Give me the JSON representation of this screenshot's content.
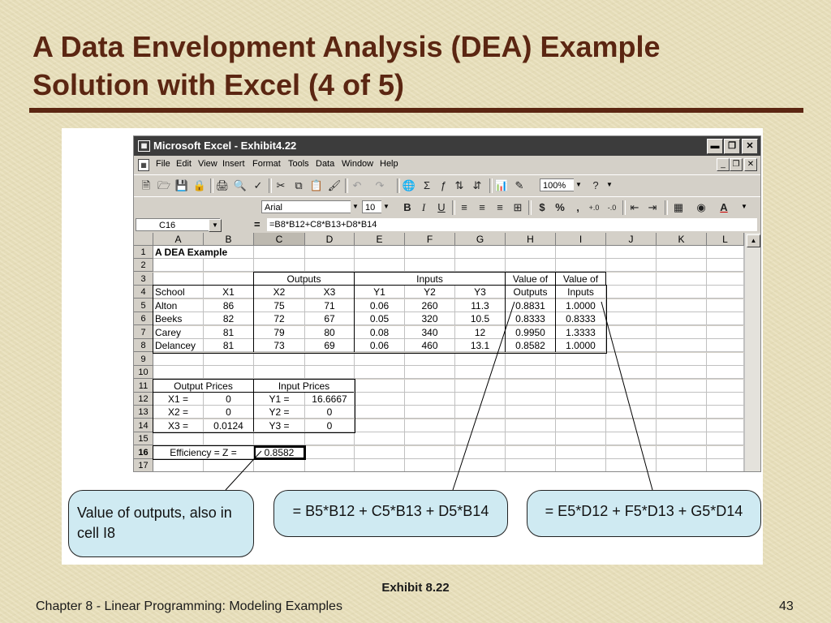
{
  "slide": {
    "title_line1": "A Data Envelopment Analysis (DEA) Example",
    "title_line2": "Solution with Excel (4 of 5)",
    "caption": "Exhibit 8.22",
    "footer_left": "Chapter 8 - Linear Programming:  Modeling Examples",
    "page_number": "43"
  },
  "window": {
    "title": "Microsoft Excel - Exhibit4.22",
    "menu": [
      "File",
      "Edit",
      "View",
      "Insert",
      "Format",
      "Tools",
      "Data",
      "Window",
      "Help"
    ]
  },
  "toolbar": {
    "zoom": "100%",
    "font_name": "Arial",
    "font_size": "10",
    "bold_label": "B",
    "italic_label": "I",
    "underline_label": "U",
    "currency_label": "$",
    "percent_label": "%",
    "comma_label": ","
  },
  "formula_bar": {
    "name_box": "C16",
    "equals": "=",
    "formula": "=B8*B12+C8*B13+D8*B14"
  },
  "sheet": {
    "columns": [
      "A",
      "B",
      "C",
      "D",
      "E",
      "F",
      "G",
      "H",
      "I",
      "J",
      "K",
      "L"
    ],
    "rows": [
      "1",
      "2",
      "3",
      "4",
      "5",
      "6",
      "7",
      "8",
      "9",
      "10",
      "11",
      "12",
      "13",
      "14",
      "15",
      "16",
      "17"
    ],
    "title": "A DEA Example",
    "group_outputs": "Outputs",
    "group_inputs": "Inputs",
    "value_of_outputs": [
      "Value of",
      "Outputs"
    ],
    "value_of_inputs": [
      "Value of",
      "Inputs"
    ],
    "headers": [
      "School",
      "X1",
      "X2",
      "X3",
      "Y1",
      "Y2",
      "Y3"
    ],
    "schools": [
      {
        "name": "Alton",
        "x1": "86",
        "x2": "75",
        "x3": "71",
        "y1": "0.06",
        "y2": "260",
        "y3": "11.3",
        "vo": "0.8831",
        "vi": "1.0000"
      },
      {
        "name": "Beeks",
        "x1": "82",
        "x2": "72",
        "x3": "67",
        "y1": "0.05",
        "y2": "320",
        "y3": "10.5",
        "vo": "0.8333",
        "vi": "0.8333"
      },
      {
        "name": "Carey",
        "x1": "81",
        "x2": "79",
        "x3": "80",
        "y1": "0.08",
        "y2": "340",
        "y3": "12",
        "vo": "0.9950",
        "vi": "1.3333"
      },
      {
        "name": "Delancey",
        "x1": "81",
        "x2": "73",
        "x3": "69",
        "y1": "0.06",
        "y2": "460",
        "y3": "13.1",
        "vo": "0.8582",
        "vi": "1.0000"
      }
    ],
    "output_prices_label": "Output Prices",
    "input_prices_label": "Input Prices",
    "prices": [
      {
        "xl": "X1 =",
        "xv": "0",
        "yl": "Y1 =",
        "yv": "16.6667"
      },
      {
        "xl": "X2 =",
        "xv": "0",
        "yl": "Y2 =",
        "yv": "0"
      },
      {
        "xl": "X3 =",
        "xv": "0.0124",
        "yl": "Y3 =",
        "yv": "0"
      }
    ],
    "efficiency_label": "Efficiency = Z =",
    "efficiency_value": "0.8582"
  },
  "callouts": {
    "value_of_outputs": "Value of outputs, also in cell I8",
    "outputs_formula": "= B5*B12 + C5*B13 + D5*B14",
    "inputs_formula": "= E5*D12 + F5*D13 + G5*D14"
  }
}
